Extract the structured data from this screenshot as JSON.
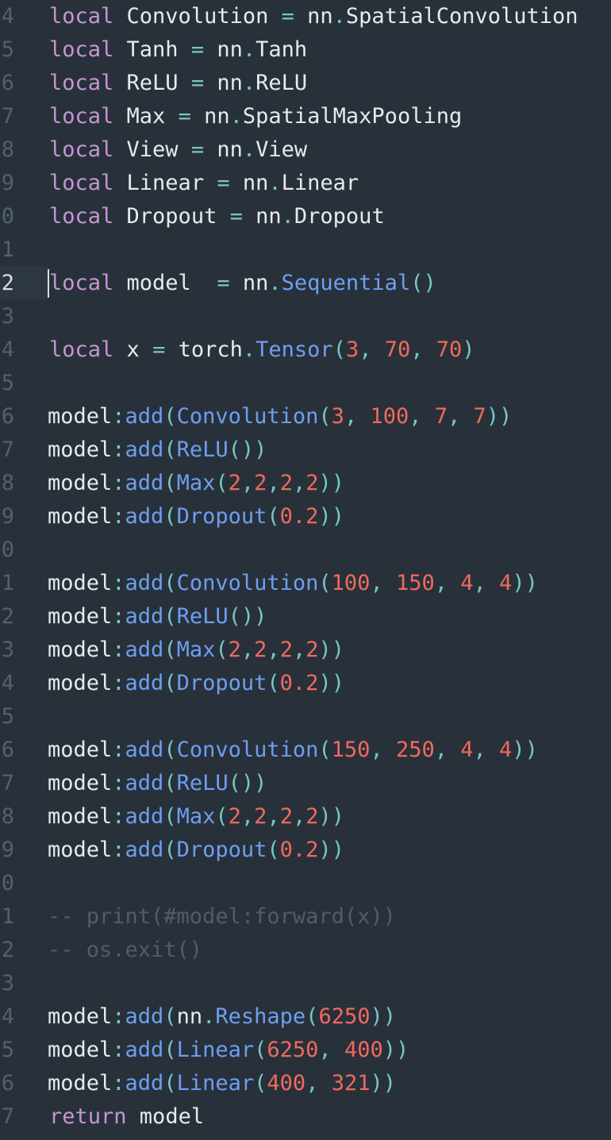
{
  "editor": {
    "language": "lua",
    "active_line": "12",
    "lines": [
      {
        "number": "4",
        "tokens": [
          [
            "kw",
            "local"
          ],
          [
            "plain",
            " Convolution "
          ],
          [
            "op",
            "="
          ],
          [
            "plain",
            " nn"
          ],
          [
            "op",
            "."
          ],
          [
            "plain",
            "SpatialConvolution"
          ]
        ]
      },
      {
        "number": "5",
        "tokens": [
          [
            "kw",
            "local"
          ],
          [
            "plain",
            " Tanh "
          ],
          [
            "op",
            "="
          ],
          [
            "plain",
            " nn"
          ],
          [
            "op",
            "."
          ],
          [
            "plain",
            "Tanh"
          ]
        ]
      },
      {
        "number": "6",
        "tokens": [
          [
            "kw",
            "local"
          ],
          [
            "plain",
            " ReLU "
          ],
          [
            "op",
            "="
          ],
          [
            "plain",
            " nn"
          ],
          [
            "op",
            "."
          ],
          [
            "plain",
            "ReLU"
          ]
        ]
      },
      {
        "number": "7",
        "tokens": [
          [
            "kw",
            "local"
          ],
          [
            "plain",
            " Max "
          ],
          [
            "op",
            "="
          ],
          [
            "plain",
            " nn"
          ],
          [
            "op",
            "."
          ],
          [
            "plain",
            "SpatialMaxPooling"
          ]
        ]
      },
      {
        "number": "8",
        "tokens": [
          [
            "kw",
            "local"
          ],
          [
            "plain",
            " View "
          ],
          [
            "op",
            "="
          ],
          [
            "plain",
            " nn"
          ],
          [
            "op",
            "."
          ],
          [
            "plain",
            "View"
          ]
        ]
      },
      {
        "number": "9",
        "tokens": [
          [
            "kw",
            "local"
          ],
          [
            "plain",
            " Linear "
          ],
          [
            "op",
            "="
          ],
          [
            "plain",
            " nn"
          ],
          [
            "op",
            "."
          ],
          [
            "plain",
            "Linear"
          ]
        ]
      },
      {
        "number": "0",
        "tokens": [
          [
            "kw",
            "local"
          ],
          [
            "plain",
            " Dropout "
          ],
          [
            "op",
            "="
          ],
          [
            "plain",
            " nn"
          ],
          [
            "op",
            "."
          ],
          [
            "plain",
            "Dropout"
          ]
        ]
      },
      {
        "number": "1",
        "tokens": []
      },
      {
        "number": "2",
        "active": true,
        "tokens": [
          [
            "kw",
            "local"
          ],
          [
            "plain",
            " model  "
          ],
          [
            "op",
            "="
          ],
          [
            "plain",
            " nn"
          ],
          [
            "op",
            "."
          ],
          [
            "fn",
            "Sequential"
          ],
          [
            "op",
            "()"
          ]
        ]
      },
      {
        "number": "3",
        "tokens": []
      },
      {
        "number": "4",
        "tokens": [
          [
            "kw",
            "local"
          ],
          [
            "plain",
            " x "
          ],
          [
            "op",
            "="
          ],
          [
            "plain",
            " torch"
          ],
          [
            "op",
            "."
          ],
          [
            "fn",
            "Tensor"
          ],
          [
            "op",
            "("
          ],
          [
            "num",
            "3"
          ],
          [
            "op",
            ", "
          ],
          [
            "num",
            "70"
          ],
          [
            "op",
            ", "
          ],
          [
            "num",
            "70"
          ],
          [
            "op",
            ")"
          ]
        ]
      },
      {
        "number": "5",
        "tokens": []
      },
      {
        "number": "6",
        "dedent": true,
        "tokens": [
          [
            "plain",
            "model"
          ],
          [
            "op",
            ":"
          ],
          [
            "fn",
            "add"
          ],
          [
            "op",
            "("
          ],
          [
            "fn",
            "Convolution"
          ],
          [
            "op",
            "("
          ],
          [
            "num",
            "3"
          ],
          [
            "op",
            ", "
          ],
          [
            "num",
            "100"
          ],
          [
            "op",
            ", "
          ],
          [
            "num",
            "7"
          ],
          [
            "op",
            ", "
          ],
          [
            "num",
            "7"
          ],
          [
            "op",
            "))"
          ]
        ]
      },
      {
        "number": "7",
        "dedent": true,
        "tokens": [
          [
            "plain",
            "model"
          ],
          [
            "op",
            ":"
          ],
          [
            "fn",
            "add"
          ],
          [
            "op",
            "("
          ],
          [
            "fn",
            "ReLU"
          ],
          [
            "op",
            "())"
          ]
        ]
      },
      {
        "number": "8",
        "dedent": true,
        "tokens": [
          [
            "plain",
            "model"
          ],
          [
            "op",
            ":"
          ],
          [
            "fn",
            "add"
          ],
          [
            "op",
            "("
          ],
          [
            "fn",
            "Max"
          ],
          [
            "op",
            "("
          ],
          [
            "num",
            "2"
          ],
          [
            "op",
            ","
          ],
          [
            "num",
            "2"
          ],
          [
            "op",
            ","
          ],
          [
            "num",
            "2"
          ],
          [
            "op",
            ","
          ],
          [
            "num",
            "2"
          ],
          [
            "op",
            "))"
          ]
        ]
      },
      {
        "number": "9",
        "dedent": true,
        "tokens": [
          [
            "plain",
            "model"
          ],
          [
            "op",
            ":"
          ],
          [
            "fn",
            "add"
          ],
          [
            "op",
            "("
          ],
          [
            "fn",
            "Dropout"
          ],
          [
            "op",
            "("
          ],
          [
            "num",
            "0.2"
          ],
          [
            "op",
            "))"
          ]
        ]
      },
      {
        "number": "0",
        "tokens": []
      },
      {
        "number": "1",
        "dedent": true,
        "tokens": [
          [
            "plain",
            "model"
          ],
          [
            "op",
            ":"
          ],
          [
            "fn",
            "add"
          ],
          [
            "op",
            "("
          ],
          [
            "fn",
            "Convolution"
          ],
          [
            "op",
            "("
          ],
          [
            "num",
            "100"
          ],
          [
            "op",
            ", "
          ],
          [
            "num",
            "150"
          ],
          [
            "op",
            ", "
          ],
          [
            "num",
            "4"
          ],
          [
            "op",
            ", "
          ],
          [
            "num",
            "4"
          ],
          [
            "op",
            "))"
          ]
        ]
      },
      {
        "number": "2",
        "dedent": true,
        "tokens": [
          [
            "plain",
            "model"
          ],
          [
            "op",
            ":"
          ],
          [
            "fn",
            "add"
          ],
          [
            "op",
            "("
          ],
          [
            "fn",
            "ReLU"
          ],
          [
            "op",
            "())"
          ]
        ]
      },
      {
        "number": "3",
        "dedent": true,
        "tokens": [
          [
            "plain",
            "model"
          ],
          [
            "op",
            ":"
          ],
          [
            "fn",
            "add"
          ],
          [
            "op",
            "("
          ],
          [
            "fn",
            "Max"
          ],
          [
            "op",
            "("
          ],
          [
            "num",
            "2"
          ],
          [
            "op",
            ","
          ],
          [
            "num",
            "2"
          ],
          [
            "op",
            ","
          ],
          [
            "num",
            "2"
          ],
          [
            "op",
            ","
          ],
          [
            "num",
            "2"
          ],
          [
            "op",
            "))"
          ]
        ]
      },
      {
        "number": "4",
        "dedent": true,
        "tokens": [
          [
            "plain",
            "model"
          ],
          [
            "op",
            ":"
          ],
          [
            "fn",
            "add"
          ],
          [
            "op",
            "("
          ],
          [
            "fn",
            "Dropout"
          ],
          [
            "op",
            "("
          ],
          [
            "num",
            "0.2"
          ],
          [
            "op",
            "))"
          ]
        ]
      },
      {
        "number": "5",
        "tokens": []
      },
      {
        "number": "6",
        "dedent": true,
        "tokens": [
          [
            "plain",
            "model"
          ],
          [
            "op",
            ":"
          ],
          [
            "fn",
            "add"
          ],
          [
            "op",
            "("
          ],
          [
            "fn",
            "Convolution"
          ],
          [
            "op",
            "("
          ],
          [
            "num",
            "150"
          ],
          [
            "op",
            ", "
          ],
          [
            "num",
            "250"
          ],
          [
            "op",
            ", "
          ],
          [
            "num",
            "4"
          ],
          [
            "op",
            ", "
          ],
          [
            "num",
            "4"
          ],
          [
            "op",
            "))"
          ]
        ]
      },
      {
        "number": "7",
        "dedent": true,
        "tokens": [
          [
            "plain",
            "model"
          ],
          [
            "op",
            ":"
          ],
          [
            "fn",
            "add"
          ],
          [
            "op",
            "("
          ],
          [
            "fn",
            "ReLU"
          ],
          [
            "op",
            "())"
          ]
        ]
      },
      {
        "number": "8",
        "dedent": true,
        "tokens": [
          [
            "plain",
            "model"
          ],
          [
            "op",
            ":"
          ],
          [
            "fn",
            "add"
          ],
          [
            "op",
            "("
          ],
          [
            "fn",
            "Max"
          ],
          [
            "op",
            "("
          ],
          [
            "num",
            "2"
          ],
          [
            "op",
            ","
          ],
          [
            "num",
            "2"
          ],
          [
            "op",
            ","
          ],
          [
            "num",
            "2"
          ],
          [
            "op",
            ","
          ],
          [
            "num",
            "2"
          ],
          [
            "op",
            "))"
          ]
        ]
      },
      {
        "number": "9",
        "dedent": true,
        "tokens": [
          [
            "plain",
            "model"
          ],
          [
            "op",
            ":"
          ],
          [
            "fn",
            "add"
          ],
          [
            "op",
            "("
          ],
          [
            "fn",
            "Dropout"
          ],
          [
            "op",
            "("
          ],
          [
            "num",
            "0.2"
          ],
          [
            "op",
            "))"
          ]
        ]
      },
      {
        "number": "0",
        "tokens": []
      },
      {
        "number": "1",
        "dedent": true,
        "tokens": [
          [
            "cmt",
            "-- print(#model:forward(x))"
          ]
        ]
      },
      {
        "number": "2",
        "dedent": true,
        "tokens": [
          [
            "cmt",
            "-- os.exit()"
          ]
        ]
      },
      {
        "number": "3",
        "tokens": []
      },
      {
        "number": "4",
        "dedent": true,
        "tokens": [
          [
            "plain",
            "model"
          ],
          [
            "op",
            ":"
          ],
          [
            "fn",
            "add"
          ],
          [
            "op",
            "("
          ],
          [
            "plain",
            "nn"
          ],
          [
            "op",
            "."
          ],
          [
            "fn",
            "Reshape"
          ],
          [
            "op",
            "("
          ],
          [
            "num",
            "6250"
          ],
          [
            "op",
            "))"
          ]
        ]
      },
      {
        "number": "5",
        "dedent": true,
        "tokens": [
          [
            "plain",
            "model"
          ],
          [
            "op",
            ":"
          ],
          [
            "fn",
            "add"
          ],
          [
            "op",
            "("
          ],
          [
            "fn",
            "Linear"
          ],
          [
            "op",
            "("
          ],
          [
            "num",
            "6250"
          ],
          [
            "op",
            ", "
          ],
          [
            "num",
            "400"
          ],
          [
            "op",
            "))"
          ]
        ]
      },
      {
        "number": "6",
        "dedent": true,
        "tokens": [
          [
            "plain",
            "model"
          ],
          [
            "op",
            ":"
          ],
          [
            "fn",
            "add"
          ],
          [
            "op",
            "("
          ],
          [
            "fn",
            "Linear"
          ],
          [
            "op",
            "("
          ],
          [
            "num",
            "400"
          ],
          [
            "op",
            ", "
          ],
          [
            "num",
            "321"
          ],
          [
            "op",
            "))"
          ]
        ]
      },
      {
        "number": "7",
        "tokens": [
          [
            "kw",
            "return"
          ],
          [
            "plain",
            " model"
          ]
        ]
      }
    ]
  },
  "colors": {
    "background": "#28313a",
    "keyword": "#c695d3",
    "operator": "#76c8c5",
    "function": "#6f9ef1",
    "number": "#f1695e",
    "text": "#e7eaee",
    "comment": "#4f5d69",
    "gutter": "#53616d"
  }
}
